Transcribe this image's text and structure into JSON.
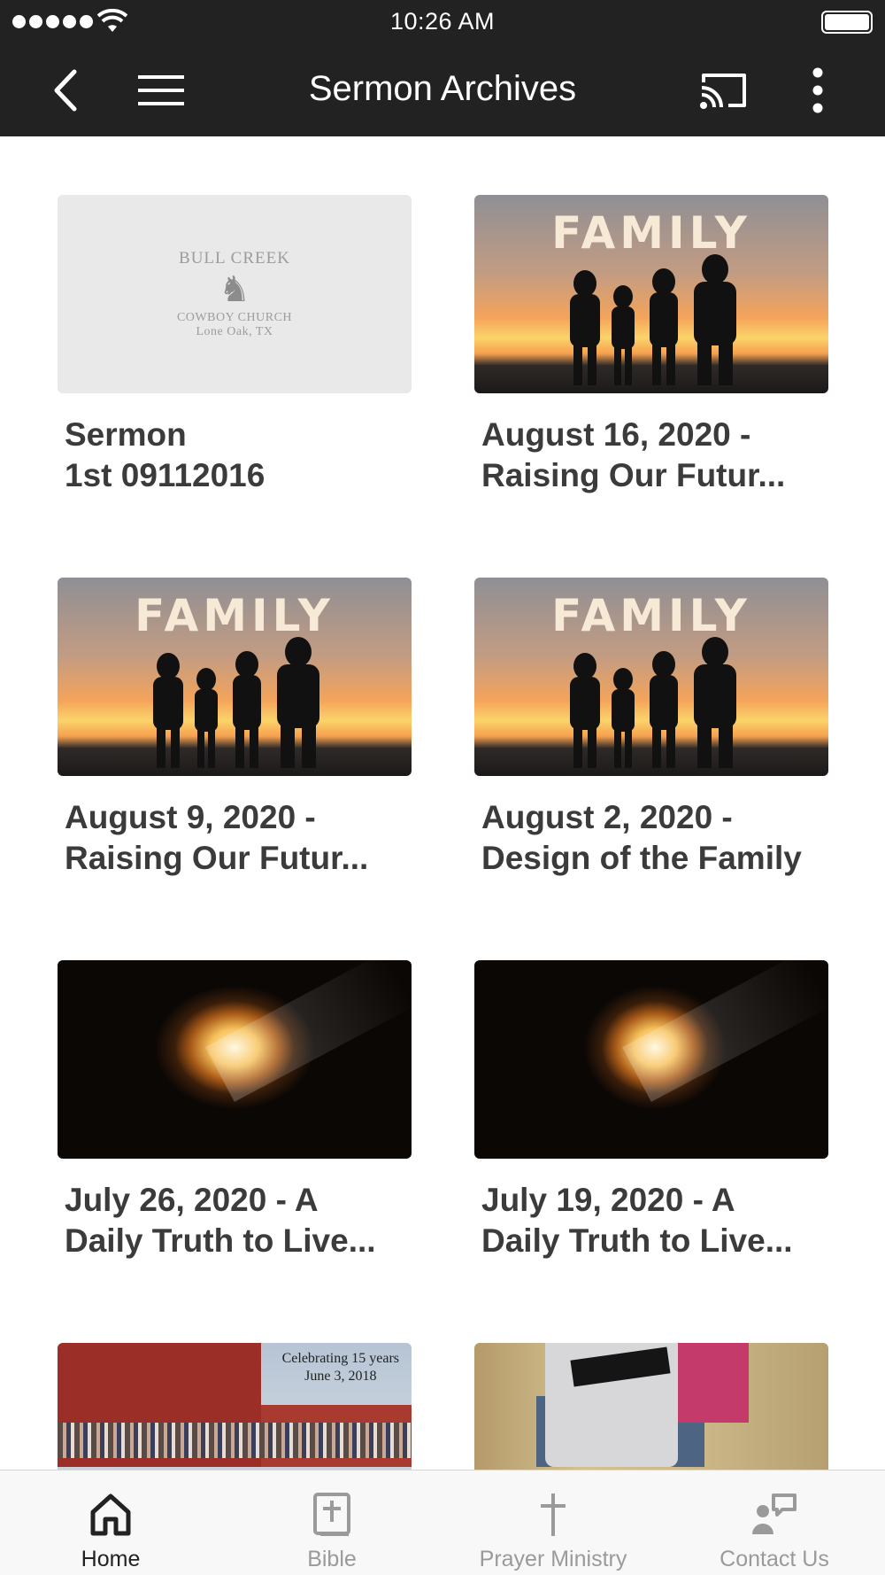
{
  "status_bar": {
    "time": "10:26 AM"
  },
  "header": {
    "title": "Sermon Archives"
  },
  "sermons": [
    {
      "title": "Sermon\n1st 09112016",
      "thumbnail": "placeholder",
      "placeholder_top": "BULL CREEK",
      "placeholder_sub1": "COWBOY CHURCH",
      "placeholder_sub2": "Lone Oak, TX"
    },
    {
      "title": "August 16, 2020 -\nRaising Our Futur...",
      "thumbnail": "family",
      "overlay_text": "FAMILY"
    },
    {
      "title": "August 9, 2020 -\nRaising Our Futur...",
      "thumbnail": "family",
      "overlay_text": "FAMILY"
    },
    {
      "title": "August 2, 2020 -\nDesign of the Family",
      "thumbnail": "family",
      "overlay_text": "FAMILY"
    },
    {
      "title": "July 26, 2020 - A\nDaily Truth to Live...",
      "thumbnail": "tomb"
    },
    {
      "title": "July 19, 2020 - A\nDaily Truth to Live...",
      "thumbnail": "tomb"
    },
    {
      "title": "",
      "thumbnail": "barn",
      "caption_line1": "Celebrating 15 years",
      "caption_line2": "June 3, 2018"
    },
    {
      "title": "",
      "thumbnail": "bible"
    }
  ],
  "tab_bar": {
    "tabs": [
      {
        "label": "Home",
        "icon": "home-icon",
        "active": true
      },
      {
        "label": "Bible",
        "icon": "bible-icon",
        "active": false
      },
      {
        "label": "Prayer Ministry",
        "icon": "cross-icon",
        "active": false
      },
      {
        "label": "Contact Us",
        "icon": "contact-icon",
        "active": false
      }
    ]
  },
  "colors": {
    "bar": "#222222",
    "active_tab": "#222222",
    "inactive_tab": "#9a9a9a"
  }
}
